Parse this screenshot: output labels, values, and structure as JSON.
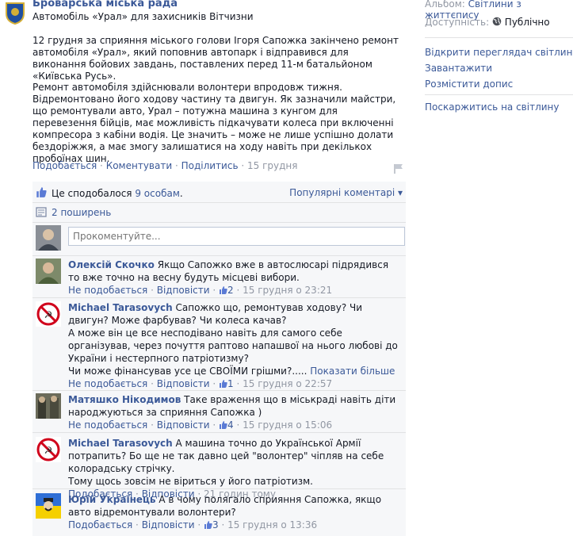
{
  "post": {
    "page_name": "Броварська міська рада",
    "album_title": "Автомобіль «Урал» для захисників Вітчизни",
    "paragraph1": "12 грудня за сприяння міського голови Ігоря Сапожка закінчено ремонт автомобіля «Урал», який поповнив автопарк і відправився для виконання бойових завдань, поставлених перед 11-м батальйоном «Київська Русь».",
    "paragraph2": "Ремонт автомобіля здійснювали волонтери впродовж тижня. Відремонтовано його ходову частину та двигун. Як зазначили майстри, що ремонтували авто, Урал – потужна машина з кунгом для перевезення бійців, має можливість підкачувати колеса при включенні компресора з кабіни водія. Це значить – може не лише успішно долати бездоріжжя, а має змогу залишатися на ходу навіть при декількох пробоїнах шин.",
    "actions": {
      "like": "Подобається",
      "comment": "Коментувати",
      "share": "Поділитись",
      "date": "15 грудня",
      "sep": " · "
    }
  },
  "social": {
    "likes_prefix": "Це сподобалося ",
    "likes_link": "9 особам",
    "likes_suffix": ".",
    "shares": "2 поширень",
    "sort": "Популярні коментарі ▾"
  },
  "comment_input": {
    "placeholder": "Прокоментуйте..."
  },
  "comments": [
    {
      "author": "Олексій Скочко",
      "text": "Якщо Сапожко вже в автослюсарі підрядився то вже точно на весну будуть місцеві вибори.",
      "like": "Не подобається",
      "reply": "Відповісти",
      "likes": "2",
      "time": "15 грудня о 23:21",
      "more": ""
    },
    {
      "author": "Michael Tarasovych",
      "text": "Сапожко що, ремонтував ходову? Чи двигун? Може фарбував? Чи колеса качав?\nА може він це все несподівано навіть для самого себе організував, через почуття раптово напашвої на нього любові до України і нестерпного патріотизму?\nЧи може фінансував усе це СВОЇМИ грішми?.....",
      "like": "Не подобається",
      "reply": "Відповісти",
      "likes": "1",
      "time": "15 грудня о 22:57",
      "more": "Показати більше"
    },
    {
      "author": "Матяшко Нікодимов",
      "text": "Таке враження що в міськраді навіть діти народжуються за сприяння Сапожка )",
      "like": "Не подобається",
      "reply": "Відповісти",
      "likes": "4",
      "time": "15 грудня о 15:06",
      "more": ""
    },
    {
      "author": "Michael Tarasovych",
      "text": "А машина точно до Української Армії потрапить? Бо ще не так давно цей \"волонтер\" чіпляв на себе колорадську стрічку.\nТому щось зовсім не віриться у його патріотизм.",
      "like": "Подобається",
      "reply": "Відповісти",
      "likes": "",
      "time": "21 годин тому",
      "more": ""
    },
    {
      "author": "Юрій Українець",
      "text": "А в чому полягало сприяння Сапожка, якщо авто відремонтували волонтери?",
      "like": "Подобається",
      "reply": "Відповісти",
      "likes": "3",
      "time": "15 грудня о 13:36",
      "more": ""
    }
  ],
  "sidebar": {
    "album_label": "Альбом:",
    "album_value": "Світлини з життєпису",
    "privacy_label": "Доступність:",
    "privacy_value": "Публічно",
    "links": [
      "Відкрити переглядач світлин",
      "Завантажити",
      "Розмістити допис"
    ],
    "report": "Поскаржитись на світлину"
  },
  "colors": {
    "link": "#3b5998",
    "muted": "#9197a3",
    "panel": "#f6f7f9"
  }
}
